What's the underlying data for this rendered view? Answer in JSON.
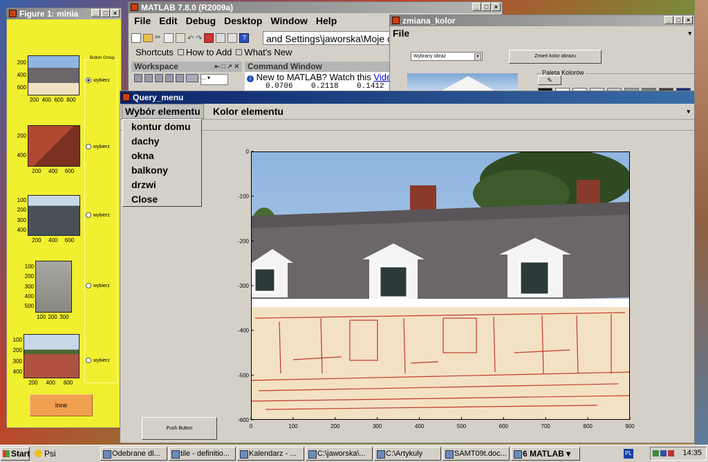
{
  "figure1": {
    "title": "Figure 1: minia",
    "button_group_label": "Button Group",
    "radio_label": "wybierz",
    "y_ticks": [
      [
        "200",
        "400",
        "600"
      ],
      [
        "200",
        "400"
      ],
      [
        "100",
        "200",
        "300",
        "400"
      ],
      [
        "100",
        "200",
        "300",
        "400",
        "500"
      ],
      [
        "100",
        "200",
        "300",
        "400"
      ]
    ],
    "x_ticks": [
      [
        "200",
        "400",
        "600",
        "800"
      ],
      [
        "200",
        "400",
        "600"
      ],
      [
        "200",
        "400",
        "600"
      ],
      [
        "100",
        "200",
        "300"
      ],
      [
        "200",
        "400",
        "600"
      ]
    ],
    "inne_button": "Inne"
  },
  "matlab": {
    "title": "MATLAB  7.8.0 (R2009a)",
    "menu": [
      "File",
      "Edit",
      "Debug",
      "Desktop",
      "Window",
      "Help"
    ],
    "current_path": "and Settings\\jaworska\\Moje do",
    "shortcuts": [
      "Shortcuts",
      "How to Add",
      "What's New"
    ],
    "workspace_label": "Workspace",
    "command_window_label": "Command Window",
    "new_to_matlab": "New to MATLAB? Watch this ",
    "video_link": "Video",
    "partial_values": "0.0706    0.2118    0.1412"
  },
  "zmiana": {
    "title": "zmiana_kolor",
    "menu_file": "File",
    "select_value": "Wybrany obraz",
    "button_label": "Zmień kolor obrazu",
    "palette_label": "Paleta Kolorów",
    "palette_colors": [
      "#000000",
      "#ffffff",
      "#f0f0f0",
      "#dcdcdc",
      "#c8c8c8",
      "#a0a0a0",
      "#787878",
      "#404040",
      "#1a2a8a"
    ]
  },
  "query": {
    "title": "Query_menu",
    "menu": [
      "Wybór elementu",
      "Kolor elementu"
    ],
    "dropdown_items": [
      "kontur domu",
      "dachy",
      "okna",
      "balkony",
      "drzwi",
      "Close"
    ],
    "push_button": "Push Button"
  },
  "chart_data": {
    "type": "image",
    "x_ticks": [
      "0",
      "100",
      "200",
      "300",
      "400",
      "500",
      "600",
      "700",
      "800",
      "900"
    ],
    "y_ticks": [
      "0",
      "-100",
      "-200",
      "-300",
      "-400",
      "-500",
      "-600"
    ],
    "xlim": [
      0,
      900
    ],
    "ylim": [
      -600,
      0
    ]
  },
  "taskbar": {
    "start": "Start",
    "items": [
      "Psi",
      "Odebrane dl...",
      "tile - definitio...",
      "Kalendarz - ...",
      "C:\\jaworska\\...",
      "C:\\Artykuly",
      "SAMT09t.doc...",
      "6 MATLAB"
    ],
    "lang": "PL",
    "clock": "14:35"
  }
}
